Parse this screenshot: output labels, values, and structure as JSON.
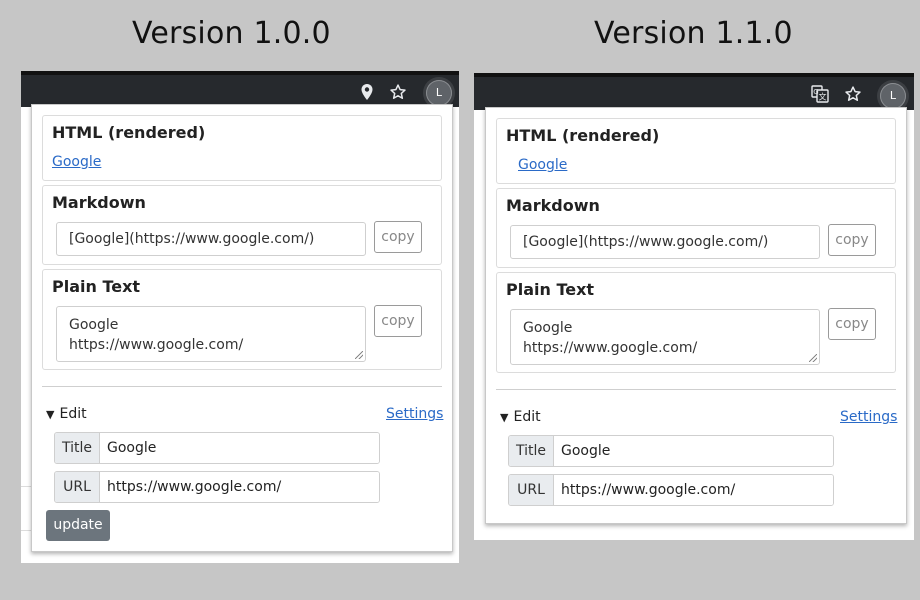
{
  "panels": [
    {
      "version_title": "Version 1.0.0",
      "toolbar_icons": [
        "location-pin-icon",
        "star-icon"
      ],
      "avatar_letter": "L",
      "html_card": {
        "title": "HTML (rendered)",
        "link_text": "Google"
      },
      "markdown_card": {
        "title": "Markdown",
        "value": "[Google](https://www.google.com/)",
        "copy_label": "copy"
      },
      "plaintext_card": {
        "title": "Plain Text",
        "value": "Google\nhttps://www.google.com/",
        "copy_label": "copy"
      },
      "edit": {
        "toggle_label": "Edit",
        "settings_label": "Settings",
        "title_label": "Title",
        "title_value": "Google",
        "url_label": "URL",
        "url_value": "https://www.google.com/",
        "update_label": "update"
      }
    },
    {
      "version_title": "Version 1.1.0",
      "toolbar_icons": [
        "translate-icon",
        "star-icon"
      ],
      "avatar_letter": "L",
      "html_card": {
        "title": "HTML (rendered)",
        "link_text": "Google"
      },
      "markdown_card": {
        "title": "Markdown",
        "value": "[Google](https://www.google.com/)",
        "copy_label": "copy"
      },
      "plaintext_card": {
        "title": "Plain Text",
        "value": "Google\nhttps://www.google.com/",
        "copy_label": "copy"
      },
      "edit": {
        "toggle_label": "Edit",
        "settings_label": "Settings",
        "title_label": "Title",
        "title_value": "Google",
        "url_label": "URL",
        "url_value": "https://www.google.com/"
      }
    }
  ],
  "colors": {
    "background": "#c6c6c6",
    "toolbar": "#26292d",
    "link": "#2a6ac7",
    "update_button": "#6c757d"
  }
}
